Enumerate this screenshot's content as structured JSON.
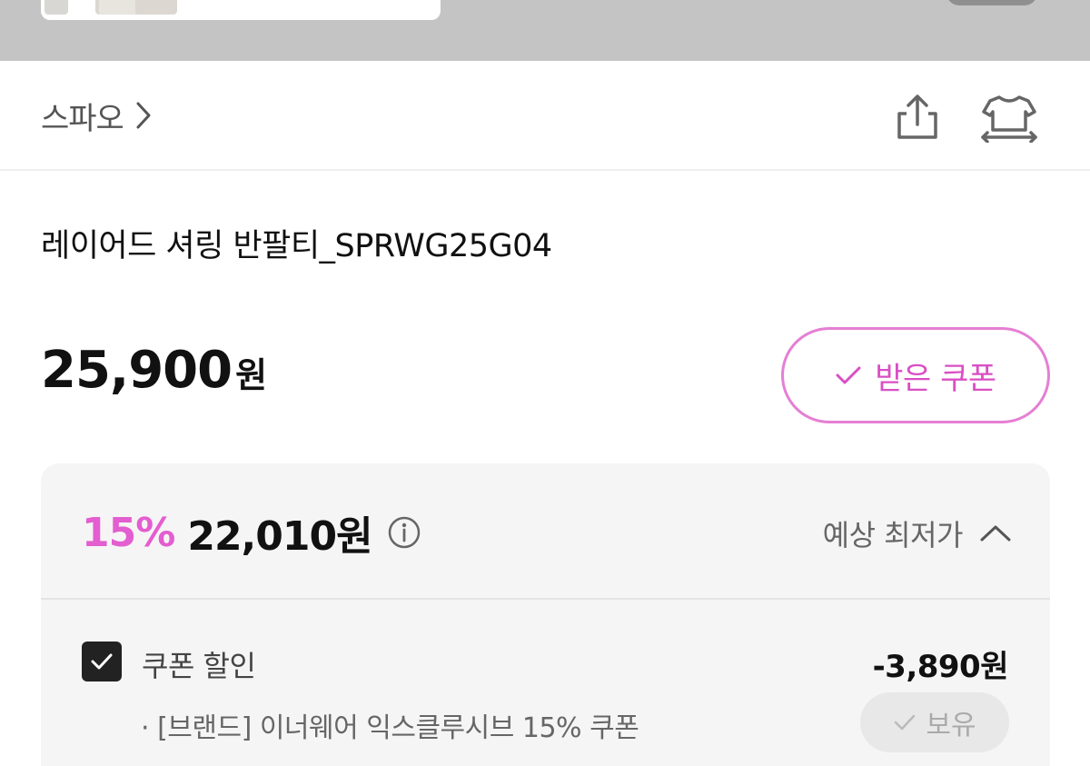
{
  "brand": {
    "name": "스파오"
  },
  "product": {
    "title": "레이어드 셔링 반팔티_SPRWG25G04",
    "price": "25,900",
    "price_unit": "원"
  },
  "coupon_button": {
    "label": "받은 쿠폰"
  },
  "benefit": {
    "discount_rate": "15%",
    "discount_price": "22,010원",
    "toggle_label": "예상 최저가",
    "coupon_row": {
      "label": "쿠폰 할인",
      "amount": "-3,890원",
      "detail": "· [브랜드] 이너웨어 익스클루시브 15% 쿠폰",
      "owned_label": "보유"
    }
  },
  "colors": {
    "accent_pink": "#e35ed0",
    "coupon_border": "#e57fd4",
    "panel_bg": "#f5f5f5"
  },
  "icons": [
    "chevron-right-icon",
    "share-icon",
    "compare-shirt-icon",
    "check-icon",
    "info-icon",
    "chevron-up-icon",
    "checkbox-checked-icon"
  ]
}
